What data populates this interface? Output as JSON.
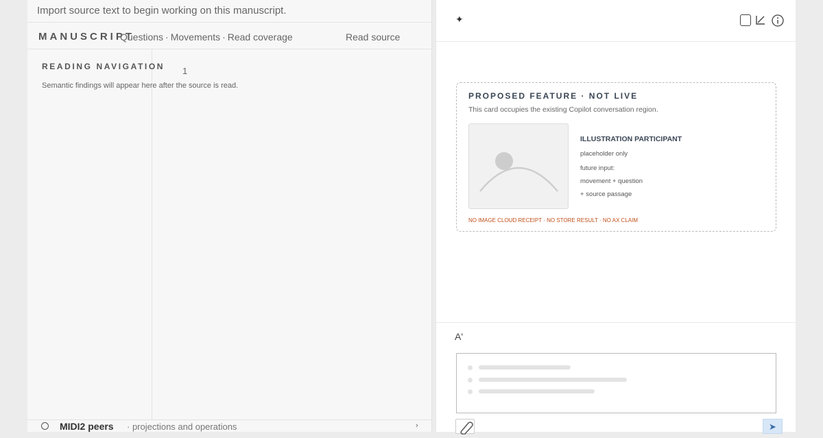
{
  "banner": {
    "import_text": "Import source text to begin working on this manuscript."
  },
  "manuscript": {
    "title": "MANUSCRIPT",
    "tabs": [
      {
        "label": "Questions"
      },
      {
        "label": "Movements"
      },
      {
        "label": "Read coverage"
      }
    ],
    "tab_separator": "·",
    "read_source_label": "Read source"
  },
  "reading_nav": {
    "title": "READING NAVIGATION",
    "hint": "Semantic findings will appear here after the source is read.",
    "page_number": "1"
  },
  "footer": {
    "name": "MIDI2 peers",
    "subtitle": "· projections and operations",
    "chevron": "›"
  },
  "right_header": {
    "sparkle": "✦"
  },
  "proposal": {
    "title": "PROPOSED FEATURE · NOT LIVE",
    "description": "This card occupies the existing Copilot conversation region.",
    "illustration_title": "ILLUSTRATION PARTICIPANT",
    "illustration_lines": [
      "placeholder only",
      "future input:",
      "movement + question",
      "+ source passage"
    ],
    "warning": "NO IMAGE CLOUD RECEIPT · NO STORE RESULT · NO AX CLAIM"
  },
  "composer": {
    "font_label": "A'",
    "send_glyph": "➤"
  },
  "colors": {
    "accent_heading": "#3a4655",
    "warning": "#c0501a",
    "send_bg": "#d7e7f7"
  }
}
